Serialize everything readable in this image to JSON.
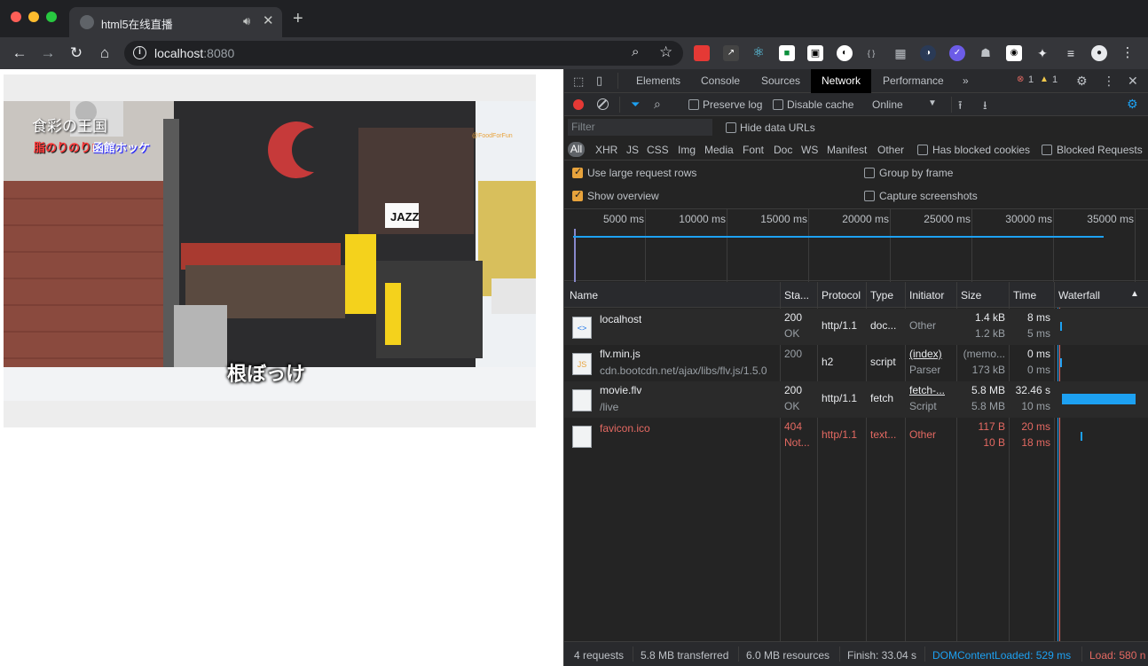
{
  "browser": {
    "tab_title": "html5在线直播",
    "url_host": "localhost",
    "url_port": ":8080",
    "ext_badge": "1"
  },
  "video": {
    "overlay_brand_line1": "食彩の王国",
    "overlay_brand_line2a": "脂のりのり!",
    "overlay_brand_line2b": "函館ホッケ",
    "overlay_watermark": "@FoodForFun",
    "sign_jazz": "JAZZ",
    "subtitle": "根ぼっけ"
  },
  "devtools": {
    "tabs": [
      "Elements",
      "Console",
      "Sources",
      "Network",
      "Performance"
    ],
    "active_tab": "Network",
    "more_tabs": "»",
    "error_count": "1",
    "warning_count": "1",
    "toolbar": {
      "preserve_log": "Preserve log",
      "disable_cache": "Disable cache",
      "throttle": "Online"
    },
    "filter_placeholder": "Filter",
    "hide_data_urls": "Hide data URLs",
    "types": [
      "All",
      "XHR",
      "JS",
      "CSS",
      "Img",
      "Media",
      "Font",
      "Doc",
      "WS",
      "Manifest",
      "Other"
    ],
    "has_blocked_cookies": "Has blocked cookies",
    "blocked_requests": "Blocked Requests",
    "use_large_rows": "Use large request rows",
    "group_by_frame": "Group by frame",
    "show_overview": "Show overview",
    "capture_screenshots": "Capture screenshots",
    "overview_ticks": [
      "5000 ms",
      "10000 ms",
      "15000 ms",
      "20000 ms",
      "25000 ms",
      "30000 ms",
      "35000 ms"
    ],
    "columns": [
      "Name",
      "Sta...",
      "Protocol",
      "Type",
      "Initiator",
      "Size",
      "Time",
      "Waterfall"
    ],
    "requests": [
      {
        "name": "localhost",
        "path": "",
        "status": "200",
        "status_text": "OK",
        "protocol": "http/1.1",
        "type": "doc...",
        "initiator": "Other",
        "initiator_sub": "",
        "size": "1.4 kB",
        "size_sub": "1.2 kB",
        "time": "8 ms",
        "time_sub": "5 ms",
        "icon": "html-doc-icon",
        "error": false
      },
      {
        "name": "flv.min.js",
        "path": "cdn.bootcdn.net/ajax/libs/flv.js/1.5.0",
        "status": "200",
        "status_text": "",
        "protocol": "h2",
        "type": "script",
        "initiator": "(index)",
        "initiator_sub": "Parser",
        "size": "(memo...",
        "size_sub": "173 kB",
        "time": "0 ms",
        "time_sub": "0 ms",
        "icon": "js-file-icon",
        "error": false
      },
      {
        "name": "movie.flv",
        "path": "/live",
        "status": "200",
        "status_text": "OK",
        "protocol": "http/1.1",
        "type": "fetch",
        "initiator": "fetch-...",
        "initiator_sub": "Script",
        "size": "5.8 MB",
        "size_sub": "5.8 MB",
        "time": "32.46 s",
        "time_sub": "10 ms",
        "icon": "blank-file-icon",
        "error": false
      },
      {
        "name": "favicon.ico",
        "path": "",
        "status": "404",
        "status_text": "Not...",
        "protocol": "http/1.1",
        "type": "text...",
        "initiator": "Other",
        "initiator_sub": "",
        "size": "117 B",
        "size_sub": "10 B",
        "time": "20 ms",
        "time_sub": "18 ms",
        "icon": "blank-file-icon",
        "error": true
      }
    ],
    "status": {
      "requests": "4 requests",
      "transferred": "5.8 MB transferred",
      "resources": "6.0 MB resources",
      "finish": "Finish: 33.04 s",
      "dcl": "DOMContentLoaded: 529 ms",
      "load": "Load: 580 n"
    },
    "colors": {
      "accent": "#1da1f2",
      "error": "#e46962",
      "dcl": "#1da1f2",
      "load": "#e46962"
    }
  }
}
